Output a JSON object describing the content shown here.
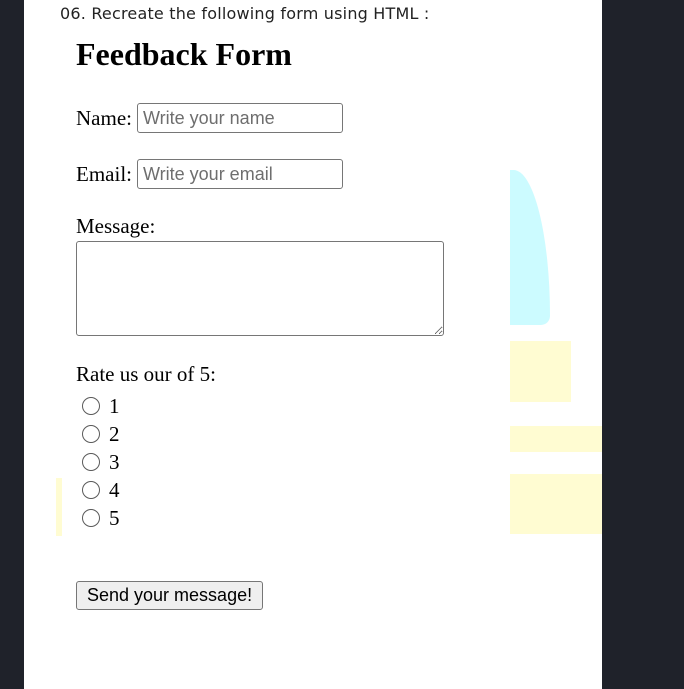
{
  "instruction": "06. Recreate the following form using HTML :",
  "form": {
    "title": "Feedback Form",
    "name_label": "Name:",
    "name_placeholder": "Write your name",
    "email_label": "Email:",
    "email_placeholder": "Write your email",
    "message_label": "Message:",
    "rating_label": "Rate us our of 5:",
    "rating_options": [
      "1",
      "2",
      "3",
      "4",
      "5"
    ],
    "submit_label": "Send your message!"
  },
  "colors": {
    "page_background": "#ffffff",
    "frame_background": "#1f222a",
    "button_background": "#efefef",
    "input_border": "#767676"
  }
}
